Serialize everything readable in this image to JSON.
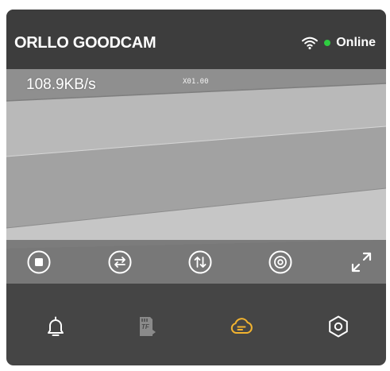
{
  "header": {
    "title": "ORLLO GOODCAM",
    "status": "Online",
    "status_color": "#2ecc40",
    "wifi_icon": "wifi-icon"
  },
  "video": {
    "bitrate": "108.9KB/s",
    "osd_text": "X01.00"
  },
  "controls": [
    {
      "icon": "stop-record-icon"
    },
    {
      "icon": "swap-horizontal-icon"
    },
    {
      "icon": "swap-vertical-icon"
    },
    {
      "icon": "snapshot-icon"
    },
    {
      "icon": "fullscreen-icon"
    }
  ],
  "bottom_nav": [
    {
      "icon": "bell-icon",
      "active": false
    },
    {
      "icon": "tf-card-icon",
      "active": false
    },
    {
      "icon": "cloud-icon",
      "active": true
    },
    {
      "icon": "settings-icon",
      "active": false
    }
  ],
  "colors": {
    "accent": "#f2b32f",
    "card_bg": "#454545",
    "header_bg": "#3d3d3d"
  }
}
